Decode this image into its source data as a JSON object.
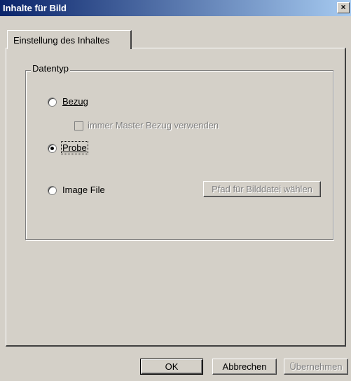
{
  "window": {
    "title": "Inhalte für Bild",
    "close_label": "×"
  },
  "tabs": [
    {
      "label": "Einstellung des Inhaltes"
    }
  ],
  "group": {
    "title": "Datentyp"
  },
  "options": {
    "bezug": {
      "label": "Bezug",
      "selected": false
    },
    "master": {
      "label": "immer Master Bezug verwenden",
      "checked": false,
      "enabled": false
    },
    "probe": {
      "label": "Probe",
      "selected": true
    },
    "image_file": {
      "label": "Image File",
      "selected": false
    }
  },
  "buttons": {
    "path": "Pfad für Bilddatei wählen",
    "ok": "OK",
    "cancel": "Abbrechen",
    "apply": "Übernehmen"
  }
}
